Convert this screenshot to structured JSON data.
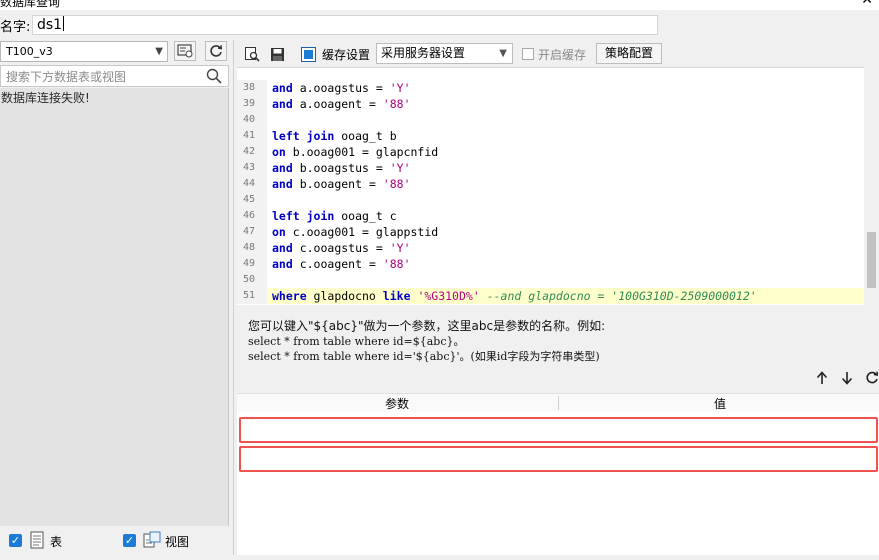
{
  "window": {
    "title": "数据库查询",
    "close_glyph": "✕"
  },
  "name_row": {
    "label": "名字:",
    "value": "ds1"
  },
  "left_panel": {
    "datasource": "T100_v3",
    "search_placeholder": "搜索下方数据表或视图",
    "message": "数据库连接失败!",
    "footer": {
      "table_label": "表",
      "view_label": "视图"
    }
  },
  "toolbar": {
    "cache_settings_label": "缓存设置",
    "strategy_value": "采用服务器设置",
    "enable_cache_label": "开启缓存",
    "strategy_config_label": "策略配置"
  },
  "editor": {
    "lines": [
      {
        "no": "38",
        "tokens": [
          [
            "kw",
            "and"
          ],
          [
            "t",
            " a.ooagstus = "
          ],
          [
            "st",
            "'Y'"
          ]
        ]
      },
      {
        "no": "39",
        "tokens": [
          [
            "kw",
            "and"
          ],
          [
            "t",
            " a.ooagent = "
          ],
          [
            "st",
            "'88'"
          ]
        ]
      },
      {
        "no": "40",
        "tokens": []
      },
      {
        "no": "41",
        "tokens": [
          [
            "kw",
            "left join"
          ],
          [
            "t",
            " ooag_t b"
          ]
        ]
      },
      {
        "no": "42",
        "tokens": [
          [
            "kw",
            "on"
          ],
          [
            "t",
            " b.ooag001 = glapcnfid"
          ]
        ]
      },
      {
        "no": "43",
        "tokens": [
          [
            "kw",
            "and"
          ],
          [
            "t",
            " b.ooagstus = "
          ],
          [
            "st",
            "'Y'"
          ]
        ]
      },
      {
        "no": "44",
        "tokens": [
          [
            "kw",
            "and"
          ],
          [
            "t",
            " b.ooagent = "
          ],
          [
            "st",
            "'88'"
          ]
        ]
      },
      {
        "no": "45",
        "tokens": []
      },
      {
        "no": "46",
        "tokens": [
          [
            "kw",
            "left join"
          ],
          [
            "t",
            " ooag_t c"
          ]
        ]
      },
      {
        "no": "47",
        "tokens": [
          [
            "kw",
            "on"
          ],
          [
            "t",
            " c.ooag001 = glappstid"
          ]
        ]
      },
      {
        "no": "48",
        "tokens": [
          [
            "kw",
            "and"
          ],
          [
            "t",
            " c.ooagstus = "
          ],
          [
            "st",
            "'Y'"
          ]
        ]
      },
      {
        "no": "49",
        "tokens": [
          [
            "kw",
            "and"
          ],
          [
            "t",
            " c.ooagent = "
          ],
          [
            "st",
            "'88'"
          ]
        ]
      },
      {
        "no": "50",
        "tokens": []
      },
      {
        "no": "51",
        "highlight": true,
        "tokens": [
          [
            "kw",
            "where"
          ],
          [
            "t",
            " glapdocno "
          ],
          [
            "kw",
            "like"
          ],
          [
            "t",
            " "
          ],
          [
            "st",
            "'%G310D%'"
          ],
          [
            "t",
            " "
          ],
          [
            "cm",
            "--and glapdocno = '100G310D-2509000012'"
          ]
        ]
      }
    ]
  },
  "hint": {
    "line1": "您可以键入\"${abc}\"做为一个参数，这里abc是参数的名称。例如:",
    "line2": "select * from table where id=${abc}。",
    "line3": "select * from table where id='${abc}'。(如果id字段为字符串类型)"
  },
  "params": {
    "col_param": "参数",
    "col_value": "值",
    "rows": 2
  },
  "colors": {
    "accent": "#1c7bd6",
    "row_highlight": "#ef5350",
    "editor_line_highlight": "#ffffcc"
  },
  "icons": [
    "dropdown-arrow-icon",
    "db-settings-icon",
    "refresh-icon",
    "search-icon",
    "preview-icon",
    "save-icon",
    "cache-icon",
    "arrow-up-icon",
    "arrow-down-icon",
    "table-icon",
    "view-icon",
    "checkbox-checked-icon"
  ]
}
